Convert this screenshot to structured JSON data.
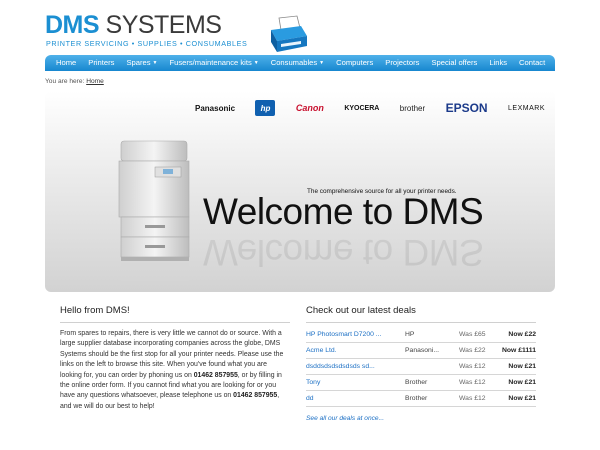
{
  "logo": {
    "brand_primary": "DMS",
    "brand_secondary": "SYSTEMS",
    "tagline": "PRINTER SERVICING • SUPPLIES • CONSUMABLES",
    "icon": "printer-icon",
    "accent": "#1b8fd2"
  },
  "nav": {
    "items": [
      {
        "label": "Home",
        "dropdown": false
      },
      {
        "label": "Printers",
        "dropdown": false
      },
      {
        "label": "Spares",
        "dropdown": true
      },
      {
        "label": "Fusers/maintenance kits",
        "dropdown": true
      },
      {
        "label": "Consumables",
        "dropdown": true
      },
      {
        "label": "Computers",
        "dropdown": false
      },
      {
        "label": "Projectors",
        "dropdown": false
      },
      {
        "label": "Special offers",
        "dropdown": false
      },
      {
        "label": "Links",
        "dropdown": false
      },
      {
        "label": "Contact",
        "dropdown": false
      }
    ],
    "caret": "▼",
    "color": "#1787cf"
  },
  "breadcrumb": {
    "prefix": "You are here: ",
    "link": "Home"
  },
  "hero": {
    "brands": {
      "panasonic": "Panasonic",
      "hp": "hp",
      "canon": "Canon",
      "kyocera": "KYOCERA",
      "brother": "brother",
      "epson": "EPSON",
      "lexmark": "LEXMARK"
    },
    "tagline": "The comprehensive source for all your printer needs.",
    "welcome": "Welcome to DMS"
  },
  "intro": {
    "title": "Hello from DMS!",
    "text_1": "From spares to repairs, there is very little we cannot do or source. With a large supplier database incorporating companies across the globe, DMS Systems should be the first stop for all your printer needs. Please use the links on the left to browse this site. When you've found what you are looking for, you can order by phoning us on ",
    "phone_1": "01462 857955",
    "text_2": ", or by filling in the online order form. If you cannot find what you are looking for or you have any questions whatsoever, please telephone us on ",
    "phone_2": "01462 857955",
    "text_3": ", and we will do our best to help!"
  },
  "deals": {
    "title": "Check out our latest deals",
    "rows": [
      {
        "name": "HP Photosmart D7200 ...",
        "maker": "HP",
        "was": "Was £65",
        "now": "Now £22"
      },
      {
        "name": "Acme Ltd.",
        "maker": "Panasoni...",
        "was": "Was £22",
        "now": "Now £1111"
      },
      {
        "name": "dsddsdsdsdsdsds sd...",
        "maker": "",
        "was": "Was £12",
        "now": "Now £21"
      },
      {
        "name": "Tony",
        "maker": "Brother",
        "was": "Was £12",
        "now": "Now £21"
      },
      {
        "name": "dd",
        "maker": "Brother",
        "was": "Was £12",
        "now": "Now £21"
      }
    ],
    "see_all": "See all our deals at once..."
  }
}
